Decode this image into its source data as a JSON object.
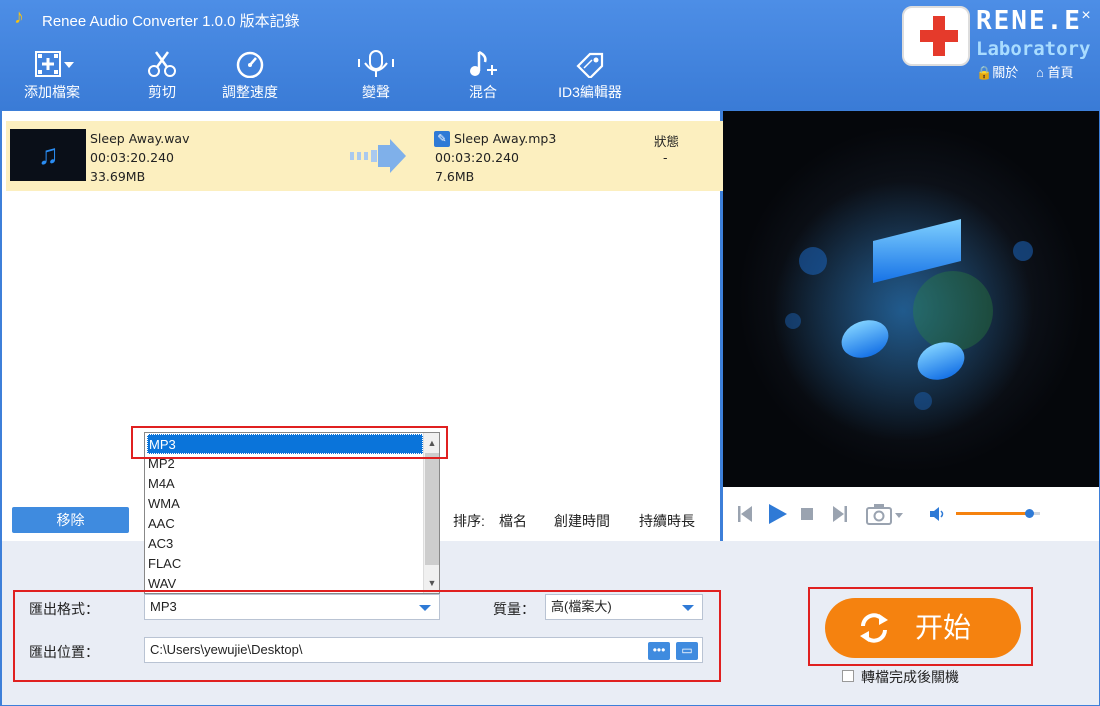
{
  "window": {
    "title": "Renee Audio Converter 1.0.0 版本記錄",
    "minimize": "−",
    "maximize": "☐",
    "close": "×"
  },
  "toolbar": [
    {
      "label": "添加檔案",
      "icon": "add-file-icon"
    },
    {
      "label": "剪切",
      "icon": "scissors-icon"
    },
    {
      "label": "調整速度",
      "icon": "speed-gauge-icon"
    },
    {
      "label": "變聲",
      "icon": "microphone-icon"
    },
    {
      "label": "混合",
      "icon": "music-mix-icon"
    },
    {
      "label": "ID3編輯器",
      "icon": "tag-icon"
    }
  ],
  "brand": {
    "name": "RENE.E",
    "sub": "Laboratory",
    "about": "關於",
    "home": "首頁"
  },
  "file": {
    "source_name": "Sleep Away.wav",
    "source_duration": "00:03:20.240",
    "source_size": "33.69MB",
    "output_name": "Sleep Away.mp3",
    "output_duration": "00:03:20.240",
    "output_size": "7.6MB",
    "status_header": "狀態",
    "status_value": "-"
  },
  "list_actions": {
    "remove": "移除",
    "sort_label": "排序:",
    "sort_name": "檔名",
    "sort_created": "創建時間",
    "sort_duration": "持續時長"
  },
  "format_options": [
    "MP3",
    "MP2",
    "M4A",
    "WMA",
    "AAC",
    "AC3",
    "FLAC",
    "WAV"
  ],
  "output": {
    "format_label": "匯出格式：",
    "format_value": "MP3",
    "quality_label": "質量：",
    "quality_value": "高(檔案大)",
    "location_label": "匯出位置：",
    "location_value": "C:\\Users\\yewujie\\Desktop\\"
  },
  "start": {
    "label": "开始",
    "shutdown_label": "轉檔完成後關機"
  },
  "player": {
    "volume": 0.87
  },
  "colors": {
    "accent": "#3a7bd6",
    "start": "#f5820f",
    "highlight_row": "#fcefbf",
    "annotation": "#e02020"
  }
}
